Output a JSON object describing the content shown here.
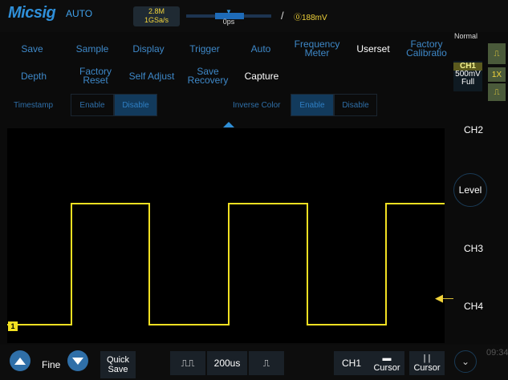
{
  "header": {
    "logo": "Micsig",
    "mode": "AUTO",
    "memory": "2.8M",
    "sample_rate": "1GSa/s",
    "timebase_offset": "0ps",
    "trigger_slope": "/",
    "trigger_level": "⓪188mV"
  },
  "menu": {
    "row1": [
      "Save",
      "Sample",
      "Display",
      "Trigger",
      "Auto",
      "Frequency\nMeter",
      "Userset",
      "Factory\nCalibratio"
    ],
    "row2": [
      "Depth",
      "Factory\nReset",
      "Self Adjust",
      "Save\nRecovery",
      "Capture"
    ]
  },
  "options": {
    "timestamp_label": "Timestamp",
    "timestamp_enable": "Enable",
    "timestamp_disable": "Disable",
    "inverse_label": "Inverse Color",
    "inverse_enable": "Enable",
    "inverse_disable": "Disable"
  },
  "right_panel": {
    "mode": "Normal",
    "ch1_name": "CH1",
    "ch1_scale": "500mV",
    "ch1_bw": "Full",
    "probe": "1X",
    "ch2": "CH2",
    "level": "Level",
    "ch3": "CH3",
    "ch4": "CH4"
  },
  "bottom": {
    "fine": "Fine",
    "quick_save_1": "Quick",
    "quick_save_2": "Save",
    "timebase": "200us",
    "cursor1": "Cursor",
    "cursor2": "Cursor",
    "ch1_badge": "CH1",
    "time": "09:34"
  },
  "waveform": {
    "channel_marker": "1",
    "color": "#f2e022",
    "accent": "#2f8fd8"
  }
}
